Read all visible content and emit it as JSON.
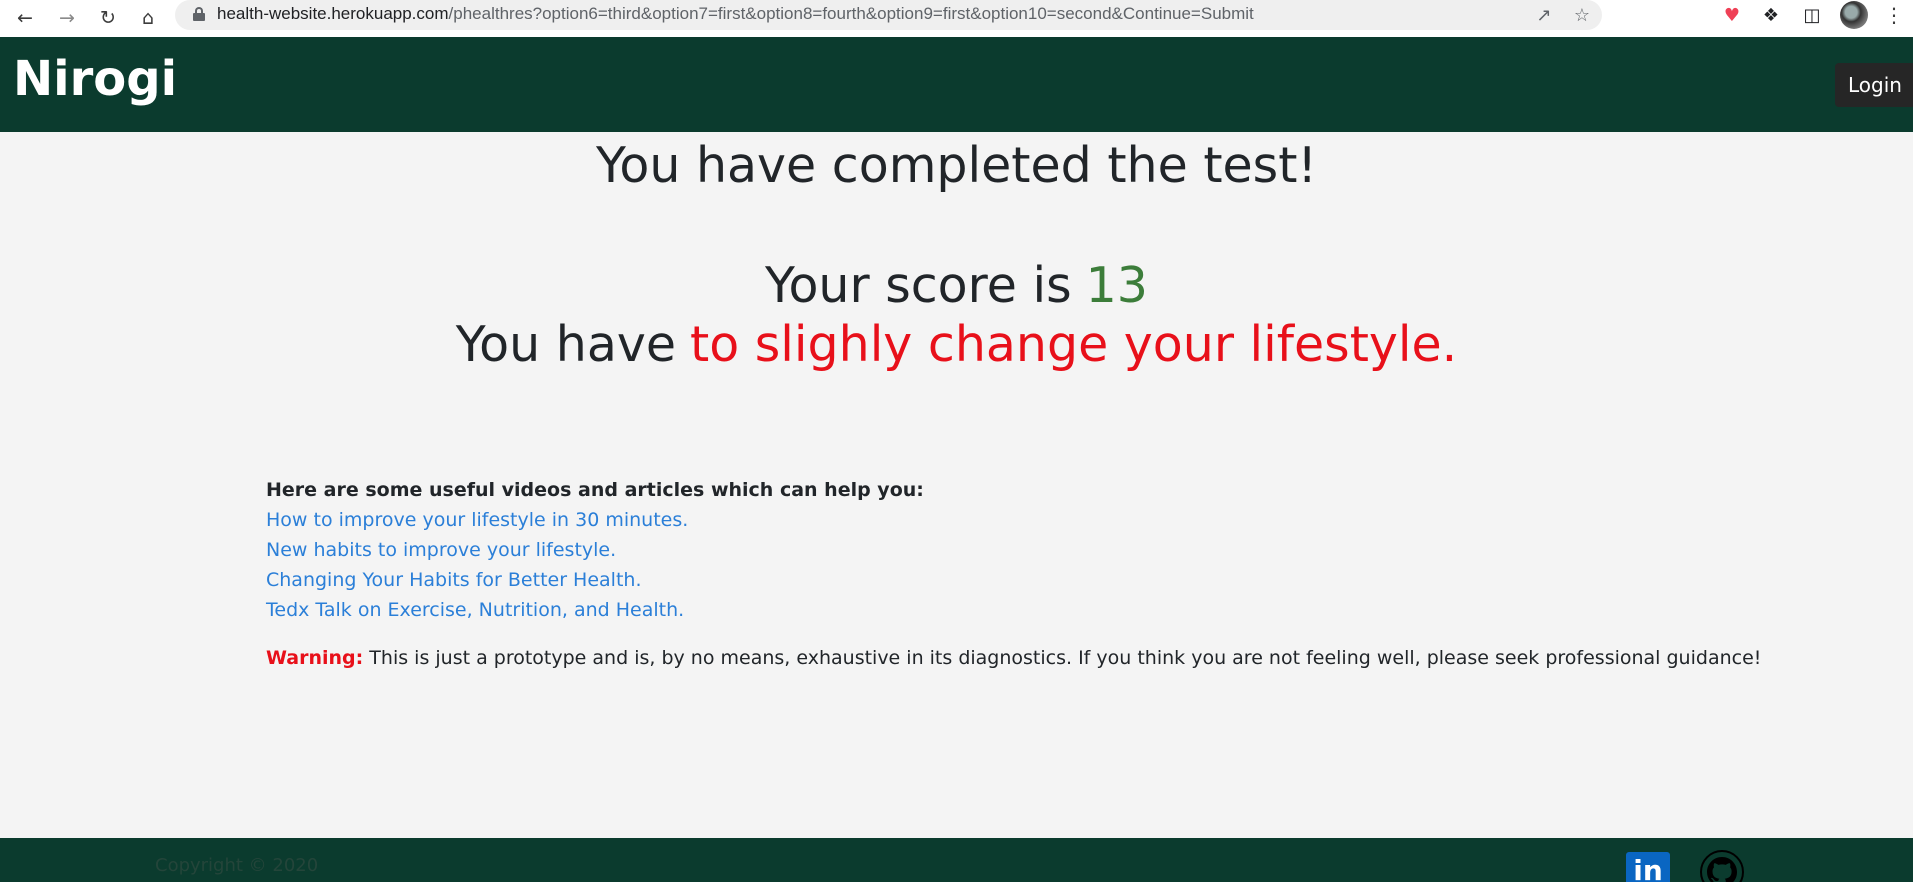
{
  "browser": {
    "url_host": "health-website.herokuapp.com",
    "url_path": "/phealthres?option6=third&option7=first&option8=fourth&option9=first&option10=second&Continue=Submit"
  },
  "navbar": {
    "brand": "Nirogi",
    "login_label": "Login"
  },
  "result": {
    "title": "You have completed the test!",
    "score_prefix": "Your score is",
    "score_value": "13",
    "verdict_prefix": "You have",
    "verdict_value": "to slighly change your lifestyle."
  },
  "resources": {
    "heading": "Here are some useful videos and articles which can help you:",
    "links": [
      "How to improve your lifestyle in 30 minutes.",
      "New habits to improve your lifestyle.",
      "Changing Your Habits for Better Health.",
      "Tedx Talk on Exercise, Nutrition, and Health."
    ]
  },
  "warning": {
    "label": "Warning:",
    "text": "This is just a prototype and is, by no means, exhaustive in its diagnostics. If you think you are not feeling well, please seek professional guidance!"
  },
  "footer": {
    "copyright": "Copyright © 2020",
    "linkedin_label": "in"
  },
  "colors": {
    "navbar_bg": "#0b3b2e",
    "score_green": "#3c7d3a",
    "warning_red": "#e8101a",
    "link_blue": "#2b7fd8"
  },
  "icons": {
    "back": "back-arrow-icon",
    "forward": "forward-arrow-icon",
    "reload": "reload-icon",
    "home": "home-icon",
    "lock": "lock-icon",
    "share": "share-icon",
    "bookmark": "star-icon",
    "pocket": "pocket-icon",
    "extensions": "puzzle-icon",
    "sidebar": "sidebar-icon",
    "profile": "avatar",
    "menu": "kebab-menu-icon",
    "linkedin": "linkedin-icon",
    "github": "github-icon"
  }
}
